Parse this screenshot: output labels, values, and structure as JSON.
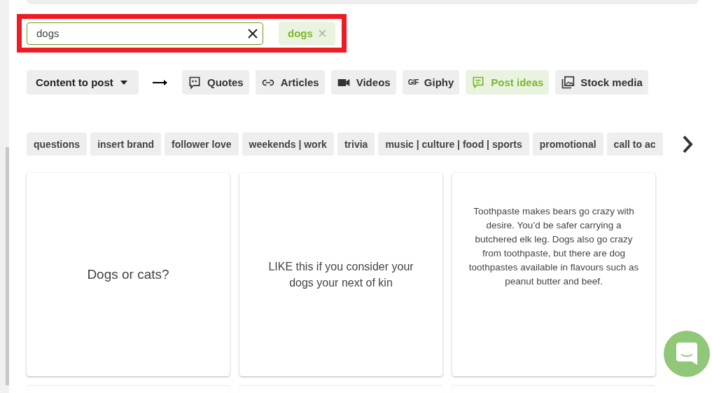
{
  "search": {
    "value": "dogs",
    "highlighted": true
  },
  "active_tags": [
    {
      "label": "dogs"
    }
  ],
  "content_menu": {
    "label": "Content to post"
  },
  "sources": [
    {
      "label": "Quotes",
      "kind": "quotes",
      "selected": false
    },
    {
      "label": "Articles",
      "kind": "articles",
      "selected": false
    },
    {
      "label": "Videos",
      "kind": "videos",
      "selected": false
    },
    {
      "label": "Giphy",
      "kind": "giphy",
      "icon_text": "GIF",
      "selected": false
    },
    {
      "label": "Post ideas",
      "kind": "ideas",
      "selected": true
    },
    {
      "label": "Stock media",
      "kind": "stock",
      "selected": false
    }
  ],
  "categories": [
    "questions",
    "insert brand",
    "follower love",
    "weekends | work",
    "trivia",
    "music | culture | food | sports",
    "promotional",
    "call to ac"
  ],
  "cards": [
    {
      "text": "Dogs or cats?",
      "kind": "large"
    },
    {
      "text": "LIKE this if you consider your dogs your next of kin",
      "kind": "medium"
    },
    {
      "text": "Toothpaste makes bears go crazy with desire. You’d be safer carrying a butchered elk leg. Dogs also go crazy from toothpaste, but there are dog toothpastes available in flavours such as peanut butter and beef.",
      "kind": "small"
    }
  ]
}
